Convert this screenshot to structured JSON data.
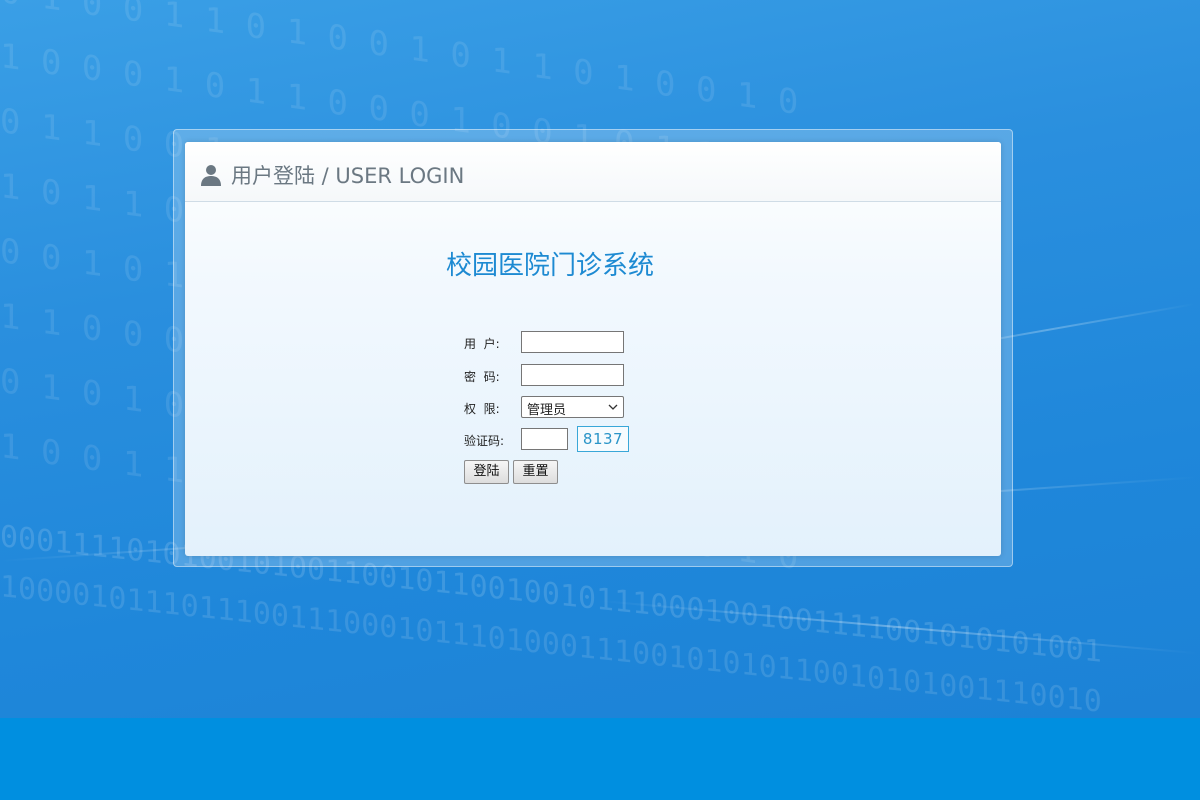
{
  "background": {
    "binary_rows": [
      "0 1 0 0 1 1 0 1 0 0 1 0 1 1 0 1 0 0 1 0",
      "1 0 0 0 1 0 1 1 0 0 0 1 0 0 1 0 1 1 0 0",
      "0 1 1 0 0 1 0 0 1 0 1 1 0 0 0 1 0 1 1 0",
      "1 0 1 1 0 0 0 1 0 1 0 0 1 0 1 1 0 0 0 1",
      "0 0 1 0 1 1 0 1 0 0 1 0 0 1 0 1 0 1 0 0",
      "1 1 0 0 0 1 0 0 1 1 0 1 0 0 1 0 0 1 1 0",
      "0 1 0 1 0 0 1 1 0 0 1 0 1 0 0 1 1 0 0 1",
      "1 0 0 1 1 0 0 0 1 0 1 1 0 1 0 0 1 0 1 0",
      "0001111010100101001100101100100101110001001001111001010101001",
      "1000010111011100111000101110100011100101010110010101001110010"
    ],
    "accent_color": "#2a8fde",
    "footer_color": "#008fe0"
  },
  "header": {
    "title": "用户登陆 / USER LOGIN",
    "icon": "user-icon"
  },
  "system_title": "校园医院门诊系统",
  "form": {
    "username_label": "用  户:",
    "username_value": "",
    "password_label": "密  码:",
    "password_value": "",
    "role_label": "权  限:",
    "role_selected": "管理员",
    "captcha_label": "验证码:",
    "captcha_value": "",
    "captcha_code": "8137"
  },
  "buttons": {
    "login_label": "登陆",
    "reset_label": "重置"
  }
}
